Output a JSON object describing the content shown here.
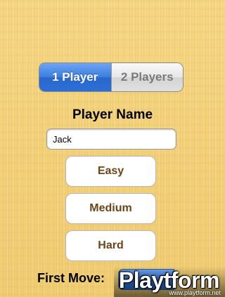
{
  "players_segment": {
    "options": [
      "1 Player",
      "2 Players"
    ],
    "selected": "1 Player"
  },
  "player_name": {
    "label": "Player Name",
    "value": "Jack"
  },
  "difficulty": {
    "buttons": [
      "Easy",
      "Medium",
      "Hard"
    ]
  },
  "first_move": {
    "label": "First Move:"
  },
  "watermark": {
    "logo": "Playtform",
    "url": "www.playtform.net"
  },
  "colors": {
    "segment_active": "#3a7ddf",
    "difficulty_text": "#6b4515",
    "background": "#f3d17a"
  }
}
